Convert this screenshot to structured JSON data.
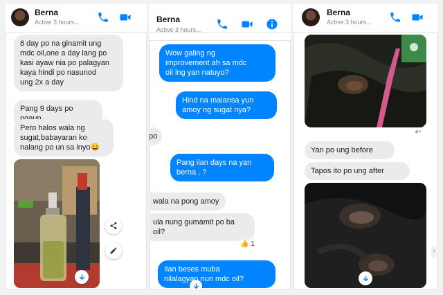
{
  "panel1": {
    "contact_name": "Berna",
    "status": "Active 3 hours...",
    "messages": [
      "8 day po na ginamit ung\nmdc oil,one a day lang po\nkasi ayaw nia po palagyan\nkaya hindi po nasunod\nung 2x a day",
      "Pang 9 days po ngaun",
      "Pero halos wala ng\nsugat,babayaran ko\nnalang po un sa inyo😀"
    ]
  },
  "panel2": {
    "contact_name": "Berna",
    "status": "Active 3 hours...",
    "messages": {
      "out1": "Wow galing ng\nimprovement ah sa  mdc\noil lng yan natuyo?",
      "out2": "Hind na malansa yun\namoy ng sugat nya?",
      "in1": "po",
      "out3": "Pang ilan days na yan\nberna ,  ?",
      "in2": "wala na pong amoy",
      "in3": "ula nung gumamit po ba\noil?",
      "reaction": "👍 1",
      "out4": "Ilan beses muba\nnilalagyan nun  mdc  oil?"
    }
  },
  "panel3": {
    "contact_name": "Berna",
    "status": "Active 3 hours...",
    "messages": [
      "Yan po ung before",
      "Tapos ito po ung after"
    ]
  },
  "colors": {
    "accent": "#0084ff",
    "incoming_bubble": "#ebebed",
    "outgoing_text": "#ffffff"
  },
  "icons": [
    "phone-icon",
    "video-camera-icon",
    "info-icon",
    "share-icon",
    "pencil-icon",
    "download-arrow-icon"
  ]
}
